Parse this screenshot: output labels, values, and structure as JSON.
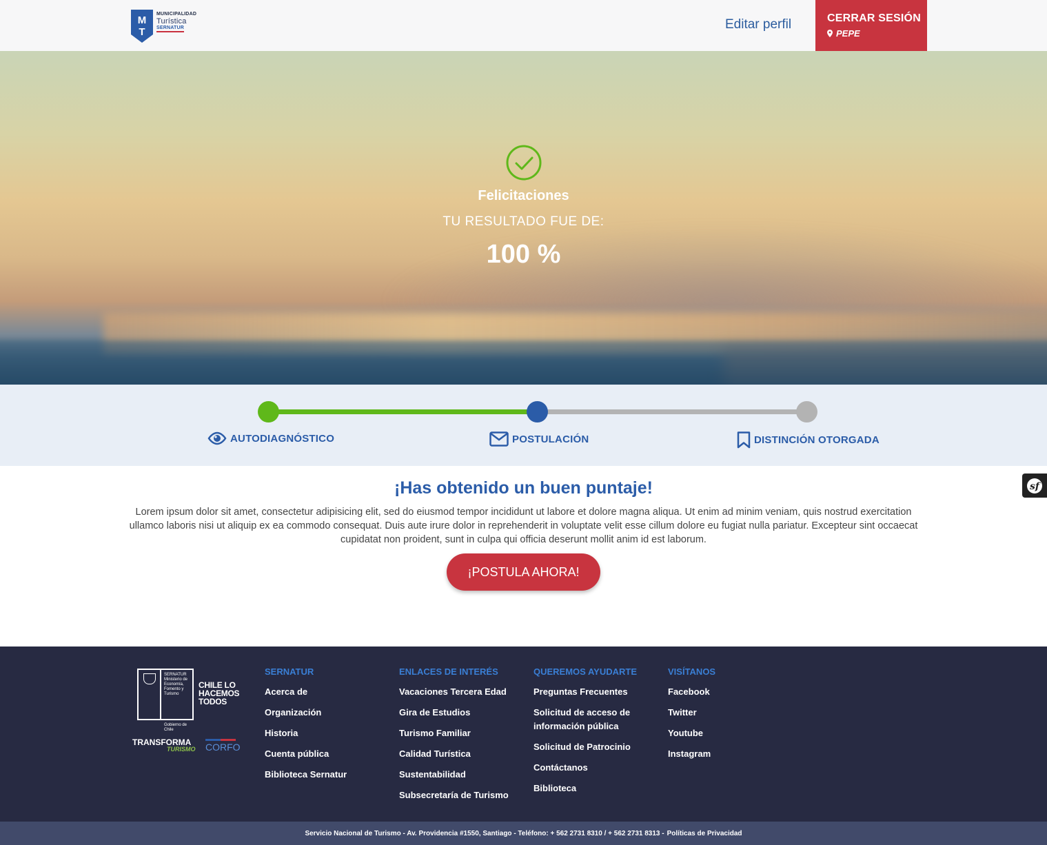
{
  "header": {
    "logo": {
      "line1": "MUNICIPALIDAD",
      "line2": "Turística",
      "line3": "SERNATUR"
    },
    "edit_profile": "Editar perfil",
    "logout": {
      "label": "CERRAR SESIÓN",
      "user": "PEPE"
    }
  },
  "hero": {
    "title": "Felicitaciones",
    "subtitle": "TU RESULTADO FUE DE:",
    "result": "100 %"
  },
  "progress": {
    "steps": [
      {
        "label": "AUTODIAGNÓSTICO",
        "icon": "eye-icon",
        "state": "done"
      },
      {
        "label": "POSTULACIÓN",
        "icon": "envelope-icon",
        "state": "current"
      },
      {
        "label": "DISTINCIÓN OTORGADA",
        "icon": "bookmark-icon",
        "state": "pending"
      }
    ],
    "completed_fraction": 0.5,
    "colors": {
      "done": "#5fb81a",
      "current": "#2b5ca8",
      "pending": "#b3b3b3"
    }
  },
  "main": {
    "title": "¡Has obtenido un buen puntaje!",
    "text": "Lorem ipsum dolor sit amet, consectetur adipisicing elit, sed do eiusmod tempor incididunt ut labore et dolore magna aliqua. Ut enim ad minim veniam, quis nostrud exercitation ullamco laboris nisi ut aliquip ex ea commodo consequat. Duis aute irure dolor in reprehenderit in voluptate velit esse cillum dolore eu fugiat nulla pariatur. Excepteur sint occaecat cupidatat non proident, sunt in culpa qui officia deserunt mollit anim id est laborum.",
    "cta": "¡POSTULA AHORA!"
  },
  "footer": {
    "logos": {
      "sernatur": "SERNATUR",
      "sernatur_sub": "Ministerio de Economía, Fomento y Turismo",
      "gobierno": "Gobierno de Chile",
      "chile": "CHILE LO HACEMOS TODOS",
      "transforma": "TRANSFORMA",
      "turismo": "TURISMO",
      "corfo": "CORFO"
    },
    "columns": [
      {
        "title": "SERNATUR",
        "links": [
          "Acerca de",
          "Organización",
          "Historia",
          "Cuenta pública",
          "Biblioteca Sernatur"
        ]
      },
      {
        "title": "ENLACES DE INTERÉS",
        "links": [
          "Vacaciones Tercera Edad",
          "Gira de Estudios",
          "Turismo Familiar",
          "Calidad Turística",
          "Sustentabilidad",
          "Subsecretaría de Turismo"
        ]
      },
      {
        "title": "QUEREMOS AYUDARTE",
        "links": [
          "Preguntas Frecuentes",
          "Solicitud de acceso de información pública",
          "Solicitud de Patrocinio",
          "Contáctanos",
          "Biblioteca"
        ]
      },
      {
        "title": "VISÍTANOS",
        "links": [
          "Facebook",
          "Twitter",
          "Youtube",
          "Instagram"
        ]
      }
    ],
    "bottom_text": "Servicio Nacional de Turismo - Av. Providencia #1550, Santiago - Teléfono: + 562 2731 8310 / + 562 2731 8313 -",
    "privacy": "Políticas de Privacidad"
  }
}
